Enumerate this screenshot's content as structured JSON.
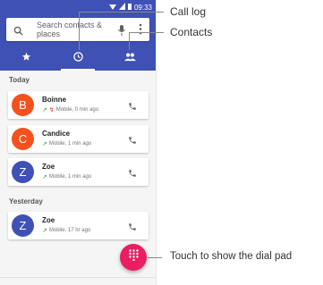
{
  "status": {
    "time": "09:33"
  },
  "search": {
    "placeholder": "Search contacts & places"
  },
  "tabs": [
    {
      "name": "favorites",
      "icon": "star-icon"
    },
    {
      "name": "call-log",
      "icon": "clock-icon",
      "active": true
    },
    {
      "name": "contacts",
      "icon": "people-icon"
    }
  ],
  "sections": {
    "today": "Today",
    "yesterday": "Yesterday"
  },
  "calls": [
    {
      "initial": "B",
      "name": "Boinne",
      "detail": "Mobile, 0 min ago",
      "color": "#f4511e"
    },
    {
      "initial": "C",
      "name": "Candice",
      "detail": "Mobile, 1 min ago",
      "color": "#f4511e"
    },
    {
      "initial": "Z",
      "name": "Zoe",
      "detail": "Mobile, 1 min ago",
      "color": "#3f51b5"
    },
    {
      "initial": "Z",
      "name": "Zoe",
      "detail": "Mobile, 17 hr ago",
      "color": "#3f51b5"
    }
  ],
  "callouts": {
    "call_log": "Call log",
    "contacts": "Contacts",
    "dial_pad": "Touch to show the dial pad"
  },
  "colors": {
    "appbar": "#3f51b5",
    "fab": "#e91e63"
  }
}
